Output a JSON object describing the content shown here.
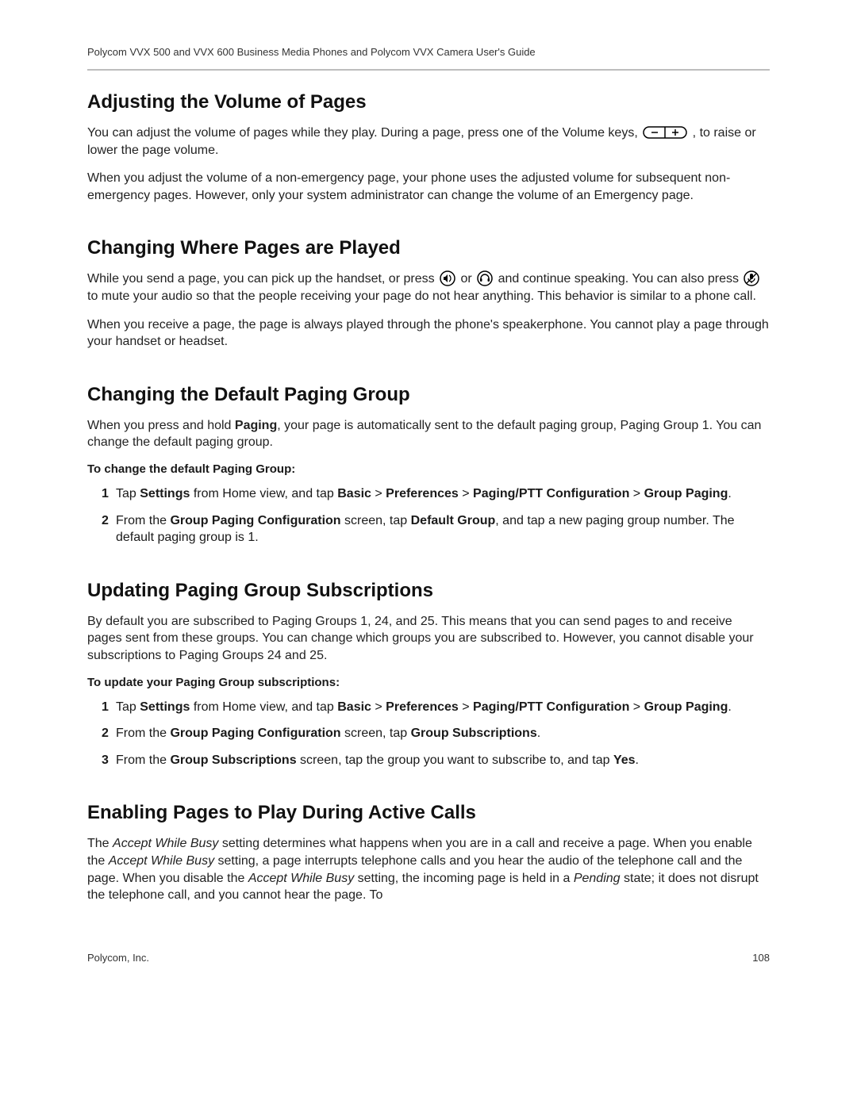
{
  "header": {
    "running": "Polycom VVX 500 and VVX 600 Business Media Phones and Polycom VVX Camera User's Guide"
  },
  "s1": {
    "title": "Adjusting the Volume of Pages",
    "p1a": "You can adjust the volume of pages while they play. During a page, press one of the Volume keys, ",
    "p1b": ", to raise or lower the page volume.",
    "p2": "When you adjust the volume of a non-emergency page, your phone uses the adjusted volume for subsequent non-emergency pages. However, only your system administrator can change the volume of an Emergency page."
  },
  "s2": {
    "title": "Changing Where Pages are Played",
    "p1a": "While you send a page, you can pick up the handset, or press ",
    "p1b": " or ",
    "p1c": " and continue speaking. You can also press ",
    "p1d": " to mute your audio so that the people receiving your page do not hear anything. This behavior is similar to a phone call.",
    "p2": "When you receive a page, the page is always played through the phone's speakerphone. You cannot play a page through your handset or headset."
  },
  "s3": {
    "title": "Changing the Default Paging Group",
    "p1a": "When you press and hold ",
    "p1b": "Paging",
    "p1c": ", your page is automatically sent to the default paging group, Paging Group 1. You can change the default paging group.",
    "sub": "To change the default Paging Group:",
    "li1": {
      "a": "Tap ",
      "b": "Settings",
      "c": " from Home view, and tap ",
      "d": "Basic",
      "e": " > ",
      "f": "Preferences",
      "g": " > ",
      "h": "Paging/PTT Configuration",
      "i": " > ",
      "j": "Group Paging",
      "k": "."
    },
    "li2": {
      "a": "From the ",
      "b": "Group Paging Configuration",
      "c": " screen, tap ",
      "d": "Default Group",
      "e": ", and tap a new paging group number. The default paging group is 1."
    }
  },
  "s4": {
    "title": "Updating Paging Group Subscriptions",
    "p1": "By default you are subscribed to Paging Groups 1, 24, and 25. This means that you can send pages to and receive pages sent from these groups. You can change which groups you are subscribed to. However, you cannot disable your subscriptions to Paging Groups 24 and 25.",
    "sub": "To update your Paging Group subscriptions:",
    "li1": {
      "a": "Tap ",
      "b": "Settings",
      "c": " from Home view, and tap ",
      "d": "Basic",
      "e": " > ",
      "f": "Preferences",
      "g": " > ",
      "h": "Paging/PTT Configuration",
      "i": " > ",
      "j": "Group Paging",
      "k": "."
    },
    "li2": {
      "a": "From the ",
      "b": "Group Paging Configuration",
      "c": " screen, tap ",
      "d": "Group Subscriptions",
      "e": "."
    },
    "li3": {
      "a": "From the ",
      "b": "Group Subscriptions",
      "c": " screen, tap the group you want to subscribe to, and tap ",
      "d": "Yes",
      "e": "."
    }
  },
  "s5": {
    "title": "Enabling Pages to Play During Active Calls",
    "p1a": "The ",
    "p1b": "Accept While Busy",
    "p1c": " setting determines what happens when you are in a call and receive a page. When you enable the ",
    "p1d": "Accept While Busy",
    "p1e": " setting, a page interrupts telephone calls and you hear the audio of the telephone call and the page. When you disable the ",
    "p1f": "Accept While Busy",
    "p1g": " setting, the incoming page is held in a ",
    "p1h": "Pending",
    "p1i": " state; it does not disrupt the telephone call, and you cannot hear the page. To"
  },
  "footer": {
    "left": "Polycom, Inc.",
    "right": "108"
  }
}
